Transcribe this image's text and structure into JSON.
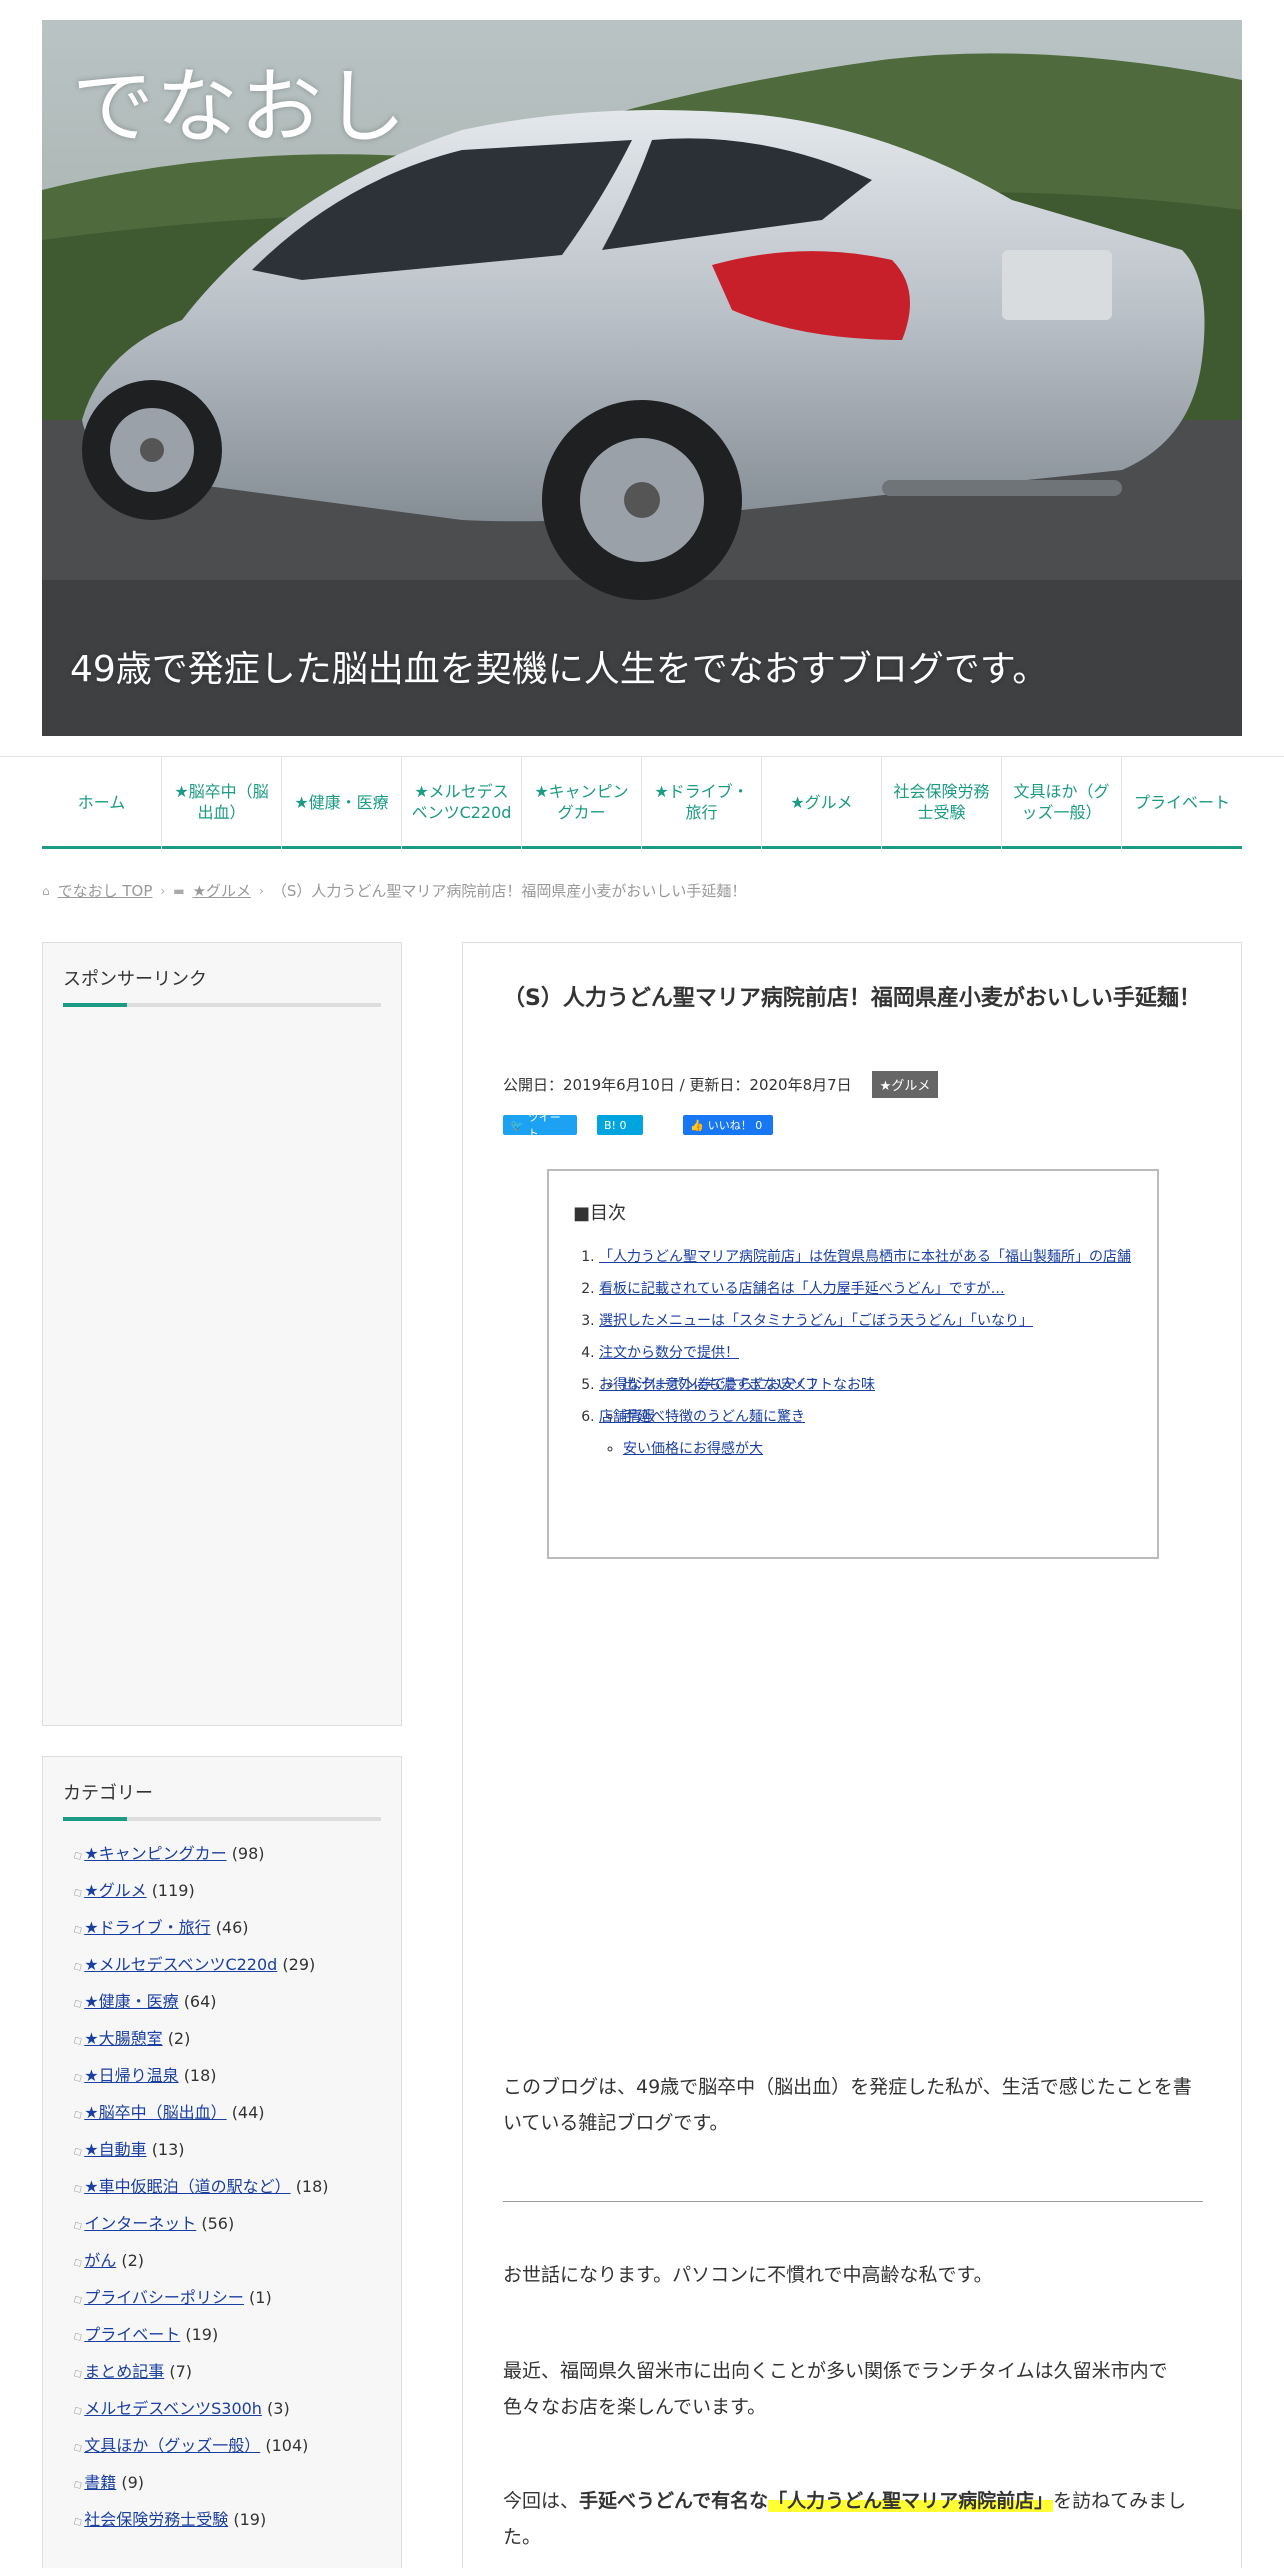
{
  "header": {
    "site_title": "でなおし",
    "tagline": "49歳で発症した脳出血を契機に人生をでなおすブログです。"
  },
  "nav": {
    "items": [
      {
        "label": "ホーム"
      },
      {
        "label": "★脳卒中（脳出血）"
      },
      {
        "label": "★健康・医療"
      },
      {
        "label": "★メルセデスベンツC220d"
      },
      {
        "label": "★キャンピングカー"
      },
      {
        "label": "★ドライブ・旅行"
      },
      {
        "label": "★グルメ"
      },
      {
        "label": "社会保険労務士受験"
      },
      {
        "label": "文具ほか（グッズ一般）"
      },
      {
        "label": "プライベート"
      }
    ]
  },
  "breadcrumb": {
    "home": "でなおし TOP",
    "category": "★グルメ",
    "current": "（S）人力うどん聖マリア病院前店！福岡県産小麦がおいしい手延麺！"
  },
  "sidebar": {
    "sponsor_title": "スポンサーリンク",
    "category_title": "カテゴリー",
    "categories": [
      {
        "name": "★キャンピングカー",
        "count": "(98)"
      },
      {
        "name": "★グルメ",
        "count": "(119)"
      },
      {
        "name": "★ドライブ・旅行",
        "count": "(46)"
      },
      {
        "name": "★メルセデスベンツC220d",
        "count": "(29)"
      },
      {
        "name": "★健康・医療",
        "count": "(64)"
      },
      {
        "name": "★大腸憩室",
        "count": "(2)"
      },
      {
        "name": "★日帰り温泉",
        "count": "(18)"
      },
      {
        "name": "★脳卒中（脳出血）",
        "count": "(44)"
      },
      {
        "name": "★自動車",
        "count": "(13)"
      },
      {
        "name": "★車中仮眠泊（道の駅など）",
        "count": "(18)"
      },
      {
        "name": "インターネット",
        "count": "(56)"
      },
      {
        "name": "がん",
        "count": "(2)"
      },
      {
        "name": "プライバシーポリシー",
        "count": "(1)"
      },
      {
        "name": "プライベート",
        "count": "(19)"
      },
      {
        "name": "まとめ記事",
        "count": "(7)"
      },
      {
        "name": "メルセデスベンツS300h",
        "count": "(3)"
      },
      {
        "name": "文具ほか（グッズ一般）",
        "count": "(104)"
      },
      {
        "name": "書籍",
        "count": "(9)"
      },
      {
        "name": "社会保険労務士受験",
        "count": "(19)"
      }
    ]
  },
  "article": {
    "title": "（S）人力うどん聖マリア病院前店！福岡県産小麦がおいしい手延麺！",
    "meta": "公開日：2019年6月10日 / 更新日：2020年8月7日",
    "category": "★グルメ",
    "share": {
      "tweet": "ツイート",
      "hatena": "B! 0",
      "like": "いいね！ 0"
    },
    "toc": {
      "title": "■目次",
      "items": [
        "「人力うどん聖マリア病院前店」は佐賀県鳥栖市に本社がある「福山製麺所」の店舗",
        "看板に記載されている店舗名は「人力屋手延べうどん」ですが…",
        "選択したメニューは「スタミナうどん」「ごぼう天うどん」「いなり」",
        "注文から数分で提供！"
      ],
      "subitems": [
        "出汁は意外にも濃すぎないソフトなお味",
        "手延べ特徴のうどん麺に驚き",
        "安い価格にお得感が大"
      ],
      "items_after": [
        "お得なクーポン券でさらにお安く！",
        "店舗情報"
      ]
    },
    "intro": "このブログは、49歳で脳卒中（脳出血）を発症した私が、生活で感じたことを書いている雑記ブログです。",
    "p1": "お世話になります。パソコンに不慣れで中高齢な私です。",
    "p2": "最近、福岡県久留米市に出向くことが多い関係でランチタイムは久留米市内で色々なお店を楽しんでいます。",
    "p3_a": "今回は、",
    "p3_b": "手延べうどんで有名な",
    "p3_c": "「人力うどん聖マリア病院前店」",
    "p3_d": "を訪ねてみました。"
  }
}
